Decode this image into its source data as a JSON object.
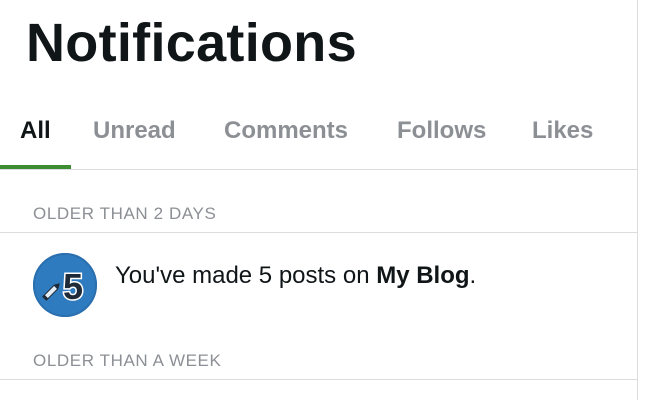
{
  "page": {
    "title": "Notifications"
  },
  "tabs": [
    {
      "label": "All",
      "active": true
    },
    {
      "label": "Unread",
      "active": false
    },
    {
      "label": "Comments",
      "active": false
    },
    {
      "label": "Follows",
      "active": false
    },
    {
      "label": "Likes",
      "active": false
    }
  ],
  "sections": [
    {
      "header": "OLDER THAN 2 DAYS",
      "notifications": [
        {
          "icon": "pencil-milestone-icon",
          "badge_number": "5",
          "text_before": "You've made 5 posts on ",
          "text_bold": "My Blog",
          "text_after": "."
        }
      ]
    },
    {
      "header": "OLDER THAN A WEEK",
      "notifications": []
    }
  ],
  "colors": {
    "accent_green": "#3c8e31",
    "muted_text": "#8c8f94",
    "primary_text": "#101517",
    "divider": "#dcdcde",
    "badge_blue": "#2f7bbf"
  }
}
